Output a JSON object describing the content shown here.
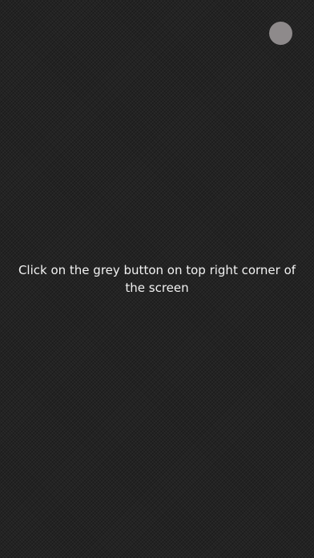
{
  "screen": {
    "instruction_text": "Click on the grey button on top right corner of the screen"
  },
  "colors": {
    "background": "#232323",
    "button": "#8e8a8b",
    "text": "#f2f2f2"
  },
  "icons": {
    "grey_button": "circle-button"
  }
}
